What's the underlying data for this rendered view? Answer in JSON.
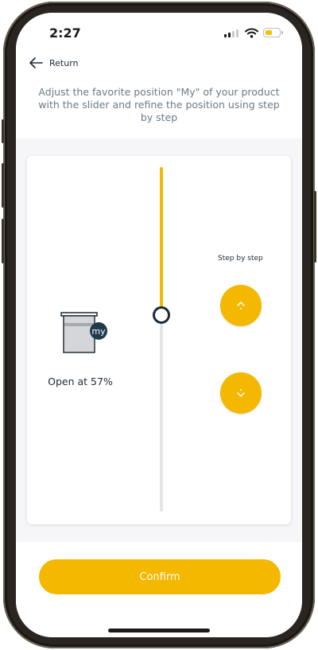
{
  "status_bar": {
    "time": "2:27",
    "battery_level": 0.45
  },
  "header": {
    "back_label": "Return",
    "instruction": "Adjust the favorite position \"My\" of your product with the slider and refine the position using step by step"
  },
  "product": {
    "badge_label": "my",
    "open_text": "Open at 57%"
  },
  "slider": {
    "value_percent": 57,
    "fill_color": "#f5b800",
    "track_color": "#e5e5e5"
  },
  "step_by_step": {
    "label": "Step by step"
  },
  "footer": {
    "confirm_label": "Confirm"
  },
  "colors": {
    "accent": "#f5b800",
    "text_dark": "#1f2a37",
    "text_muted": "#6c7a86"
  },
  "icons": [
    "back-arrow-icon",
    "chevron-up-icon",
    "chevron-down-icon",
    "wifi-icon",
    "battery-icon",
    "signal-icon",
    "blind-icon"
  ]
}
